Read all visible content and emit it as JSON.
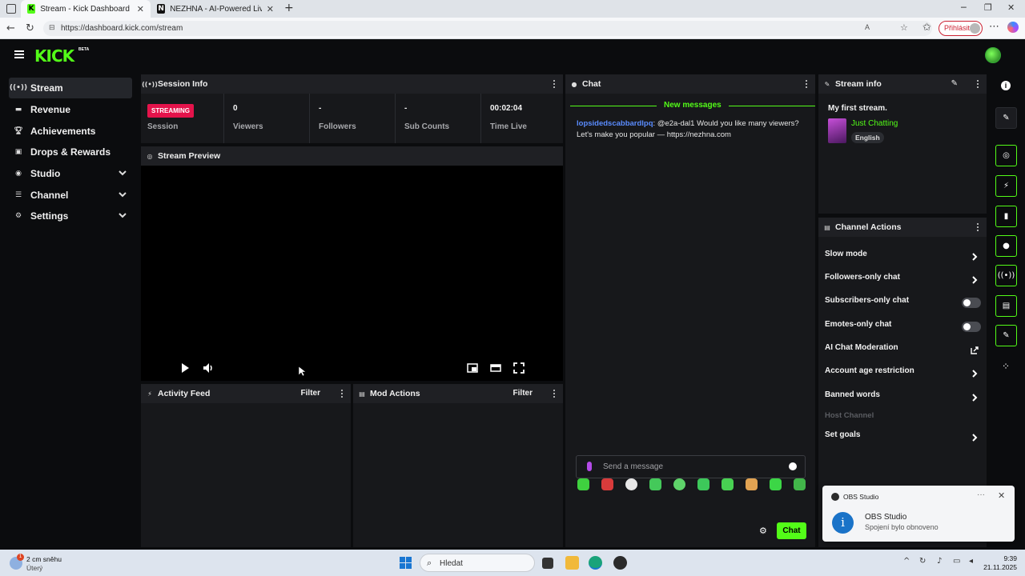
{
  "browser": {
    "tabs": [
      {
        "title": "Stream - Kick Dashboard",
        "active": true
      },
      {
        "title": "NEZHNA - AI-Powered Live Strea",
        "active": false
      }
    ],
    "url": "https://dashboard.kick.com/stream",
    "login_label": "Přihlásit"
  },
  "app": {
    "logo": "KICK",
    "beta": "BETA"
  },
  "sidebar": {
    "items": [
      {
        "label": "Stream",
        "icon": "broadcast-icon"
      },
      {
        "label": "Revenue",
        "icon": "revenue-icon"
      },
      {
        "label": "Achievements",
        "icon": "trophy-icon"
      },
      {
        "label": "Drops & Rewards",
        "icon": "gift-icon"
      },
      {
        "label": "Studio",
        "icon": "studio-icon"
      },
      {
        "label": "Channel",
        "icon": "channel-icon"
      },
      {
        "label": "Settings",
        "icon": "gear-icon"
      }
    ]
  },
  "session": {
    "title": "Session Info",
    "badge": "STREAMING",
    "session_label": "Session",
    "stats": [
      {
        "value": "0",
        "label": "Viewers"
      },
      {
        "value": "-",
        "label": "Followers"
      },
      {
        "value": "-",
        "label": "Sub Counts"
      },
      {
        "value": "00:02:04",
        "label": "Time Live"
      }
    ]
  },
  "preview": {
    "title": "Stream Preview"
  },
  "activity": {
    "title": "Activity Feed",
    "filter": "Filter"
  },
  "mod": {
    "title": "Mod Actions",
    "filter": "Filter"
  },
  "chat": {
    "title": "Chat",
    "new_messages": "New messages",
    "message": {
      "user": "lopsidedscabbardlpq",
      "text": ": @e2a-dal1 Would you like many viewers? Let's make you popular — https://nezhna.com"
    },
    "placeholder": "Send a message",
    "send_label": "Chat"
  },
  "stream_info": {
    "title": "Stream info",
    "stream_title": "My first stream.",
    "category": "Just Chatting",
    "language": "English"
  },
  "channel_actions": {
    "title": "Channel Actions",
    "items": [
      {
        "label": "Slow mode",
        "type": "arrow"
      },
      {
        "label": "Followers-only chat",
        "type": "arrow"
      },
      {
        "label": "Subscribers-only chat",
        "type": "toggle",
        "on": false
      },
      {
        "label": "Emotes-only chat",
        "type": "toggle",
        "on": false
      },
      {
        "label": "AI Chat Moderation",
        "type": "external"
      },
      {
        "label": "Account age restriction",
        "type": "arrow"
      },
      {
        "label": "Banned words",
        "type": "arrow"
      },
      {
        "label": "Host Channel",
        "type": "disabled"
      },
      {
        "label": "Set goals",
        "type": "arrow"
      }
    ]
  },
  "toast": {
    "app": "OBS Studio",
    "title": "OBS Studio",
    "message": "Spojení bylo obnoveno"
  },
  "taskbar": {
    "weather_temp": "2 cm sněhu",
    "weather_day": "Úterý",
    "weather_badge": "1",
    "search_label": "Hledat",
    "time": "9:39",
    "date": "21.11.2025"
  },
  "colors": {
    "accent": "#53fc18",
    "streaming": "#e4134b",
    "username": "#5a8cff"
  }
}
